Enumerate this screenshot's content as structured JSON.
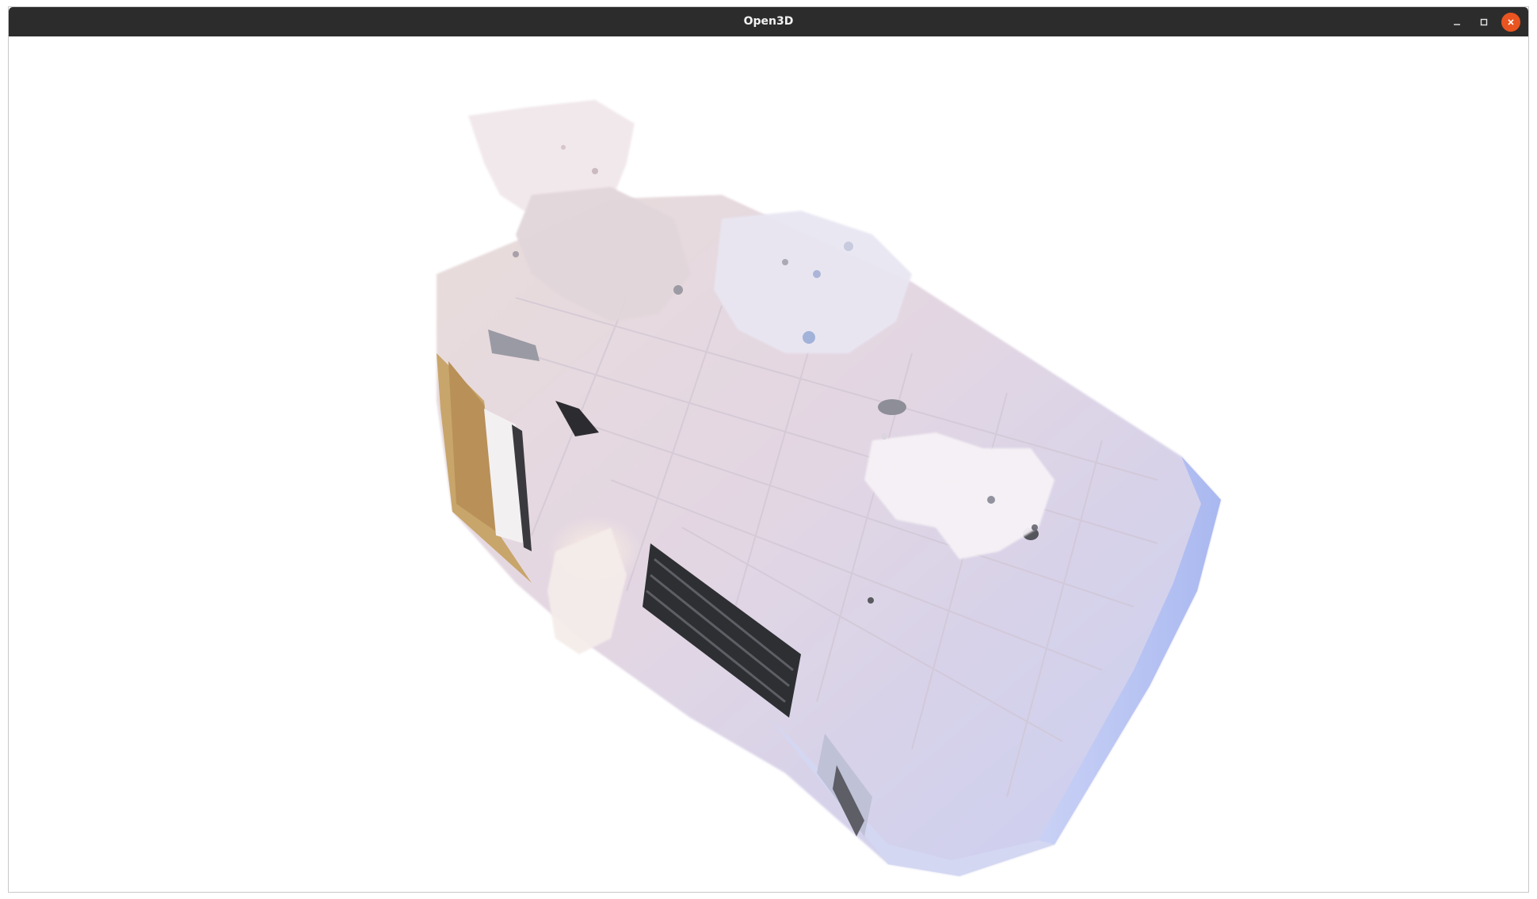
{
  "window": {
    "title": "Open3D"
  },
  "controls": {
    "minimize_icon": "minimize-icon",
    "maximize_icon": "maximize-icon",
    "close_icon": "close-icon",
    "close_color": "#e95420"
  },
  "viewport": {
    "background": "#ffffff",
    "content": "point-cloud"
  }
}
